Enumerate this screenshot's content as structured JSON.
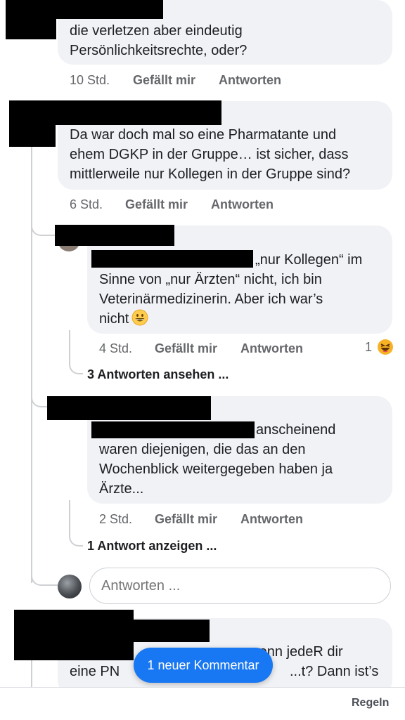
{
  "comments": [
    {
      "lines": [
        "die verletzen aber eindeutig",
        "Persönlichkeitsrechte, oder?"
      ],
      "time": "10 Std.",
      "like": "Gefällt mir",
      "reply": "Antworten"
    },
    {
      "lines": [
        "Da war doch mal so eine Pharmatante und",
        "ehem DGKP in der Gruppe… ist sicher, dass",
        "mittlerweile nur Kollegen in der Gruppe sind?"
      ],
      "time": "6 Std.",
      "like": "Gefällt mir",
      "reply": "Antworten"
    },
    {
      "lines": [
        "„nur Kollegen“ im",
        "Sinne von „nur Ärzten“ nicht, ich bin",
        "Veterinärmedizinerin. Aber ich war’s",
        "nicht"
      ],
      "time": "4 Std.",
      "like": "Gefällt mir",
      "reply": "Antworten",
      "reaction_count": "1",
      "view_replies": "3 Antworten ansehen ..."
    },
    {
      "lines": [
        "anscheinend",
        "waren  diejenigen, die das an den",
        "Wochenblick weitergegeben haben ja",
        "Ärzte..."
      ],
      "time": "2 Std.",
      "like": "Gefällt mir",
      "reply": "Antworten",
      "view_replies": "1 Antwort anzeigen ..."
    },
    {
      "lines": [
        "...enn jedeR dir",
        "eine PN",
        "...t? Dann ist’s"
      ]
    }
  ],
  "reply_box": {
    "placeholder": "Antworten ..."
  },
  "toast": {
    "label": "1 neuer Kommentar"
  },
  "footer": {
    "rules_label": "Regeln"
  },
  "colors": {
    "accent": "#1877f2",
    "bubble": "#f0f2f5",
    "meta": "#65676b"
  }
}
